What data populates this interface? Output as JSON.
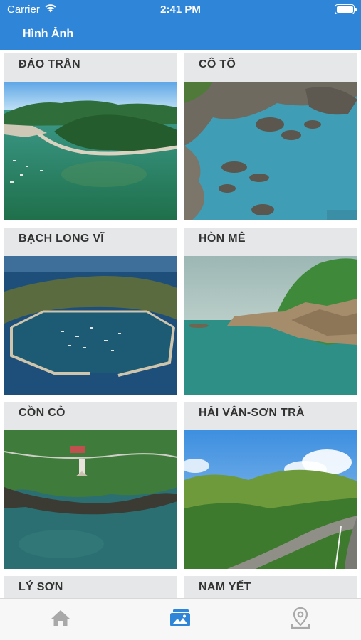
{
  "status": {
    "carrier": "Carrier",
    "time": "2:41 PM"
  },
  "nav": {
    "title": "Hình Ảnh"
  },
  "items": [
    {
      "label": "ĐẢO TRẦN"
    },
    {
      "label": "CÔ TÔ"
    },
    {
      "label": "BẠCH LONG VĨ"
    },
    {
      "label": "HÒN MÊ"
    },
    {
      "label": "CỒN CỎ"
    },
    {
      "label": "HẢI VÂN-SƠN TRÀ"
    },
    {
      "label": "LÝ SƠN"
    },
    {
      "label": "NAM YẾT"
    }
  ],
  "tabs": [
    {
      "icon": "home-icon",
      "selected": false
    },
    {
      "icon": "photo-gallery-icon",
      "selected": true
    },
    {
      "icon": "map-pin-icon",
      "selected": false
    }
  ],
  "colors": {
    "accent": "#2f86d8",
    "tab_inactive": "#a9a9a9",
    "label_bg": "#e6e7e8"
  }
}
